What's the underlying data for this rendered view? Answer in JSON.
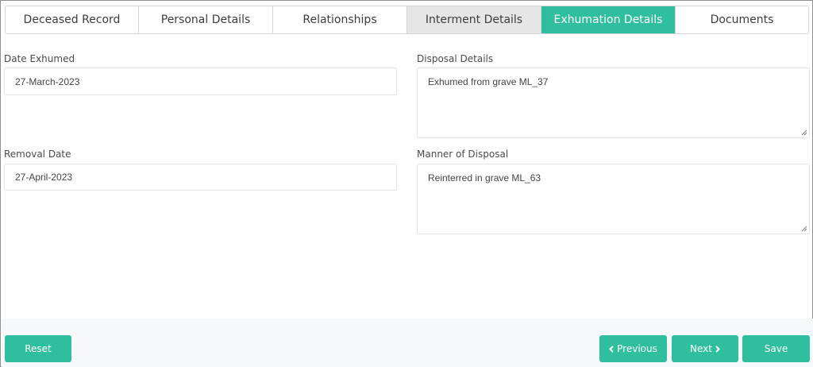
{
  "tabs": [
    {
      "label": "Deceased Record",
      "state": "default"
    },
    {
      "label": "Personal Details",
      "state": "default"
    },
    {
      "label": "Relationships",
      "state": "default"
    },
    {
      "label": "Interment Details",
      "state": "hover"
    },
    {
      "label": "Exhumation Details",
      "state": "active"
    },
    {
      "label": "Documents",
      "state": "default"
    }
  ],
  "form": {
    "date_exhumed": {
      "label": "Date Exhumed",
      "value": "27-March-2023"
    },
    "removal_date": {
      "label": "Removal Date",
      "value": "27-April-2023"
    },
    "disposal_details": {
      "label": "Disposal Details",
      "value": "Exhumed from grave ML_37"
    },
    "manner_of_disposal": {
      "label": "Manner of Disposal",
      "value": "Reinterred in grave ML_63"
    }
  },
  "footer": {
    "reset_label": "Reset",
    "previous_label": "Previous",
    "next_label": "Next",
    "save_label": "Save"
  },
  "colors": {
    "accent": "#2fbf9f",
    "tab_hover": "#e6e6e6",
    "footer_bg": "#f7f8fa"
  },
  "icons": {
    "previous": "chevron-left-icon",
    "next": "chevron-right-icon",
    "resize": "resize-grip-icon"
  }
}
